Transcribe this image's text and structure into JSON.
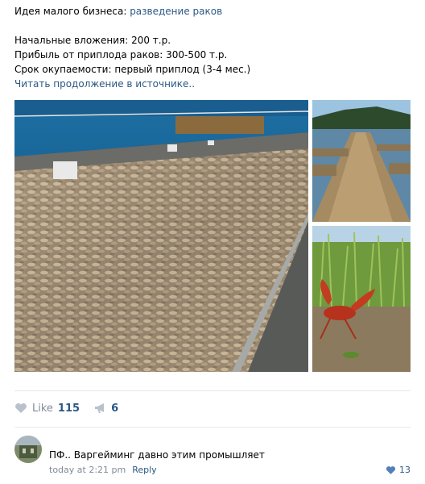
{
  "post": {
    "idea_prefix": "Идея малого бизнеса: ",
    "idea_link": "разведение раков",
    "investment": "Начальные вложения: 200 т.р.",
    "profit": "Прибыль от приплода раков: 300-500 т.р.",
    "payback": "Срок окупаемости: первый приплод (3-4 мес.)",
    "read_more": "Читать продолжение в источнике.."
  },
  "actions": {
    "like_label": "Like",
    "like_count": "115",
    "share_count": "6"
  },
  "comment": {
    "text": "ПФ.. Варгейминг давно этим промышляет",
    "time": "today at 2:21 pm",
    "reply_label": "Reply",
    "like_count": "13"
  },
  "colors": {
    "link": "#2a5885",
    "muted": "#828a99",
    "divider": "#e7e8ec"
  },
  "icons": {
    "like": "heart-icon",
    "share": "megaphone-icon",
    "comment_like": "heart-icon"
  }
}
